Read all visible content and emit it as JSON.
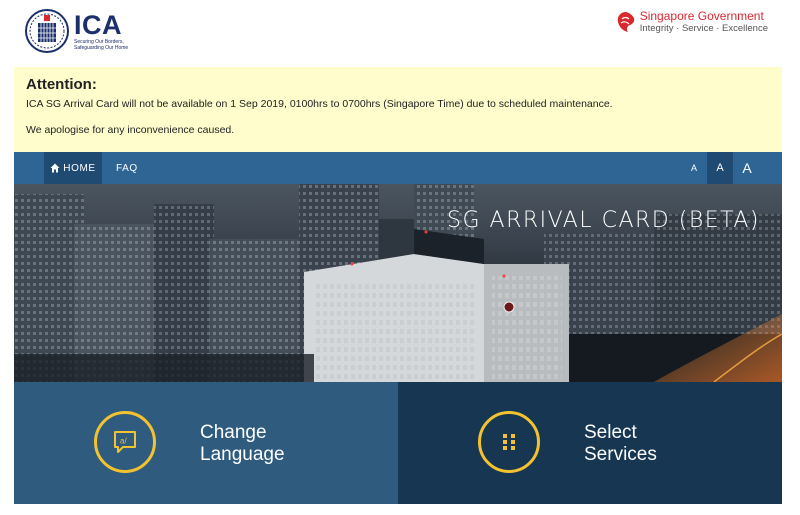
{
  "header": {
    "ica_title": "ICA",
    "ica_tagline": "Securing Our Borders, Safeguarding Our Home",
    "sg_title_1": "Singapore",
    "sg_title_2": "Government",
    "sg_subtitle": "Integrity · Service · Excellence"
  },
  "attention": {
    "title": "Attention:",
    "message": "ICA SG Arrival Card will not be available on 1 Sep 2019, 0100hrs to 0700hrs (Singapore Time) due to scheduled maintenance.",
    "apology": "We apologise for any inconvenience caused."
  },
  "nav": {
    "home_label": "HOME",
    "faq_label": "FAQ",
    "font_small": "A",
    "font_medium": "A",
    "font_large": "A"
  },
  "hero": {
    "title": "SG ARRIVAL CARD (BETA)"
  },
  "tiles": {
    "language_line1": "Change",
    "language_line2": "Language",
    "services_line1": "Select",
    "services_line2": "Services"
  },
  "icons": {
    "home": "home-icon",
    "language": "language-icon",
    "services": "grid-icon"
  },
  "colors": {
    "nav": "#2e6595",
    "nav_active": "#1f4a72",
    "tile_language": "#2e5b7e",
    "tile_services": "#163651",
    "accent": "#f2c230",
    "notice_bg": "#fffdcc"
  }
}
